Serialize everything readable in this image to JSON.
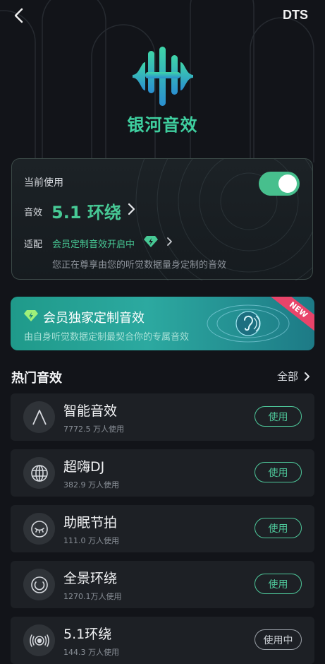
{
  "header": {
    "back_icon": "chevron-left-icon",
    "right_label": "DTS"
  },
  "logo": {
    "icon": "sound-wave-logo-icon",
    "title": "银河音效"
  },
  "current": {
    "label": "当前使用",
    "toggle_on": true,
    "effect_label": "音效",
    "effect_value": "5.1 环绕",
    "fit_label": "适配",
    "fit_value": "会员定制音效开启中",
    "fit_description": "您正在尊享由您的听觉数据量身定制的音效"
  },
  "banner": {
    "title": "会员独家定制音效",
    "subtitle": "由自身听觉数据定制最契合你的专属音效",
    "badge": "NEW"
  },
  "hot": {
    "title": "热门音效",
    "all_label": "全部",
    "items": [
      {
        "name": "智能音效",
        "count": "7772.5 万人使用",
        "icon": "letter-a-icon",
        "button": "使用",
        "active": false
      },
      {
        "name": "超嗨DJ",
        "count": "382.9 万人使用",
        "icon": "globe-icon",
        "button": "使用",
        "active": false
      },
      {
        "name": "助眠节拍",
        "count": "111.0 万人使用",
        "icon": "sleeping-eye-icon",
        "button": "使用",
        "active": false
      },
      {
        "name": "全景环绕",
        "count": "1270.1万人使用",
        "icon": "surround-ring-icon",
        "button": "使用",
        "active": false
      },
      {
        "name": "5.1环绕",
        "count": "144.3 万人使用",
        "icon": "speaker-waves-icon",
        "button": "使用中",
        "active": true
      }
    ]
  },
  "colors": {
    "accent": "#47c995",
    "background": "#121419",
    "card": "#1d2025",
    "ribbon": "#e9446a"
  }
}
